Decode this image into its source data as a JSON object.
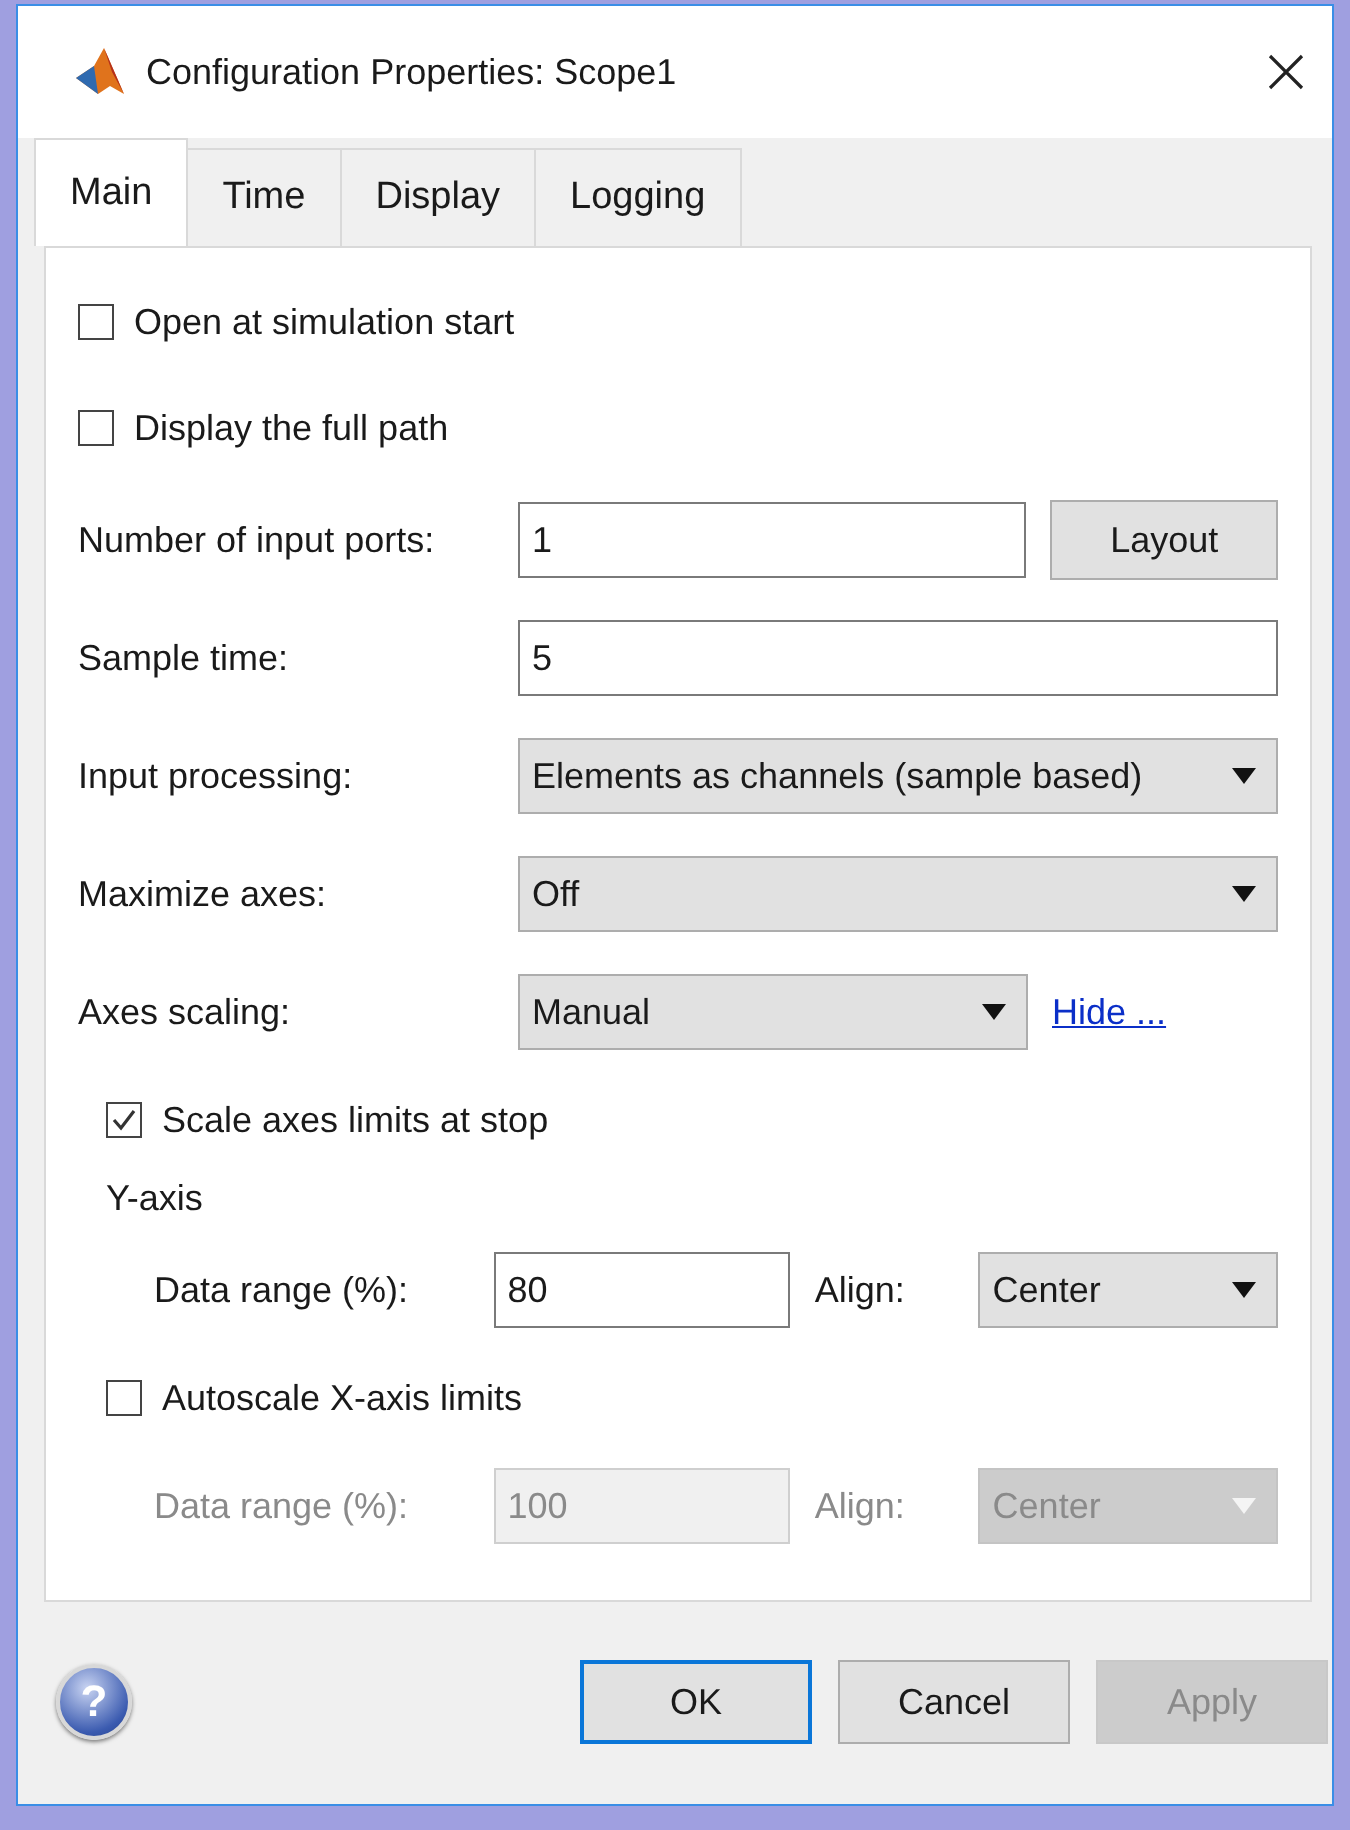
{
  "window": {
    "title": "Configuration Properties: Scope1"
  },
  "tabs": [
    {
      "label": "Main",
      "selected": true
    },
    {
      "label": "Time",
      "selected": false
    },
    {
      "label": "Display",
      "selected": false
    },
    {
      "label": "Logging",
      "selected": false
    }
  ],
  "rows": [
    {
      "kind": "checkbox",
      "label": "Open at simulation start",
      "checked": false
    },
    {
      "kind": "checkbox",
      "label": "Display the full path",
      "checked": false
    },
    {
      "kind": "text",
      "label": "Number of input ports:",
      "value": "1",
      "button": "Layout"
    },
    {
      "kind": "text",
      "label": "Sample time:",
      "value": "5"
    },
    {
      "kind": "dropdown",
      "label": "Input processing:",
      "value": "Elements as channels (sample based)"
    },
    {
      "kind": "dropdown",
      "label": "Maximize axes:",
      "value": "Off"
    },
    {
      "kind": "dropdown",
      "label": "Axes scaling:",
      "value": "Manual",
      "link": "Hide ..."
    }
  ],
  "scaling": [
    {
      "kind": "checkbox",
      "label": "Scale axes limits at stop",
      "checked": true
    },
    {
      "kind": "heading",
      "label": "Y-axis"
    },
    {
      "kind": "range",
      "label": "Data range (%):",
      "value": "80",
      "align_label": "Align:",
      "align_value": "Center",
      "disabled": false
    },
    {
      "kind": "checkbox",
      "label": "Autoscale X-axis limits",
      "checked": false
    },
    {
      "kind": "range",
      "label": "Data range (%):",
      "value": "100",
      "align_label": "Align:",
      "align_value": "Center",
      "disabled": true
    }
  ],
  "help": "?",
  "buttons": [
    {
      "label": "OK",
      "focused": true,
      "disabled": false
    },
    {
      "label": "Cancel",
      "focused": false,
      "disabled": false
    },
    {
      "label": "Apply",
      "focused": false,
      "disabled": true
    }
  ]
}
